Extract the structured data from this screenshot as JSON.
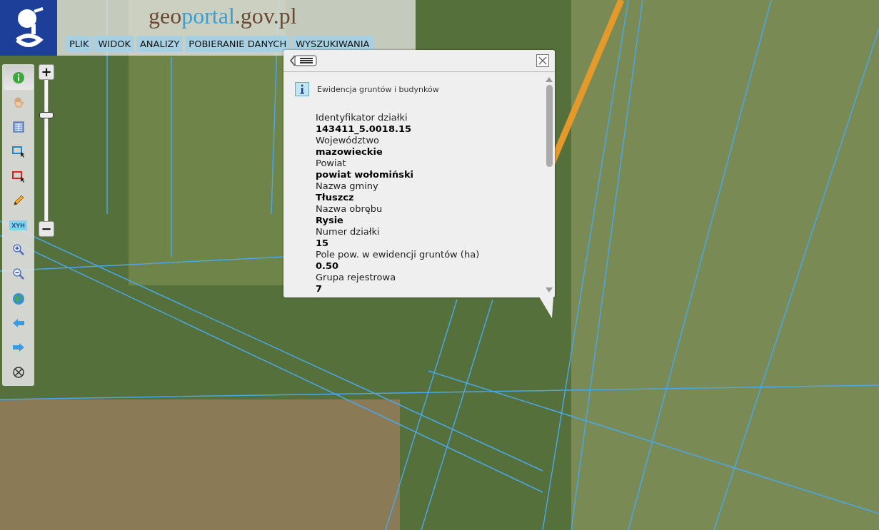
{
  "header": {
    "logo_parts": [
      {
        "text": "geo",
        "color": "#6b4a35"
      },
      {
        "text": "portal",
        "color": "#3a9fd0"
      },
      {
        "text": ".gov.pl",
        "color": "#6b4a35"
      }
    ],
    "menu": [
      {
        "label": "PLIK"
      },
      {
        "label": "WIDOK"
      },
      {
        "label": "ANALIZY"
      },
      {
        "label": "POBIERANIE DANYCH"
      },
      {
        "label": "WYSZUKIWANIA"
      }
    ]
  },
  "toolbar": [
    {
      "kind": "info",
      "selected": true
    },
    {
      "kind": "pan",
      "selected": false
    },
    {
      "kind": "table",
      "selected": false
    },
    {
      "kind": "select-blue",
      "selected": false
    },
    {
      "kind": "select-red",
      "selected": false
    },
    {
      "kind": "pencil",
      "selected": false
    },
    {
      "kind": "xyh",
      "label": "XYH",
      "selected": false
    },
    {
      "kind": "zoom-in",
      "selected": false
    },
    {
      "kind": "zoom-out",
      "selected": false
    },
    {
      "kind": "globe",
      "selected": false
    },
    {
      "kind": "back",
      "selected": false
    },
    {
      "kind": "forward",
      "selected": false
    },
    {
      "kind": "crosshair",
      "selected": false
    }
  ],
  "zoom_slider": {
    "plus": "+",
    "minus": "−",
    "level": 0.76
  },
  "popup": {
    "title": "Ewidencja gruntów i budynków",
    "fields": [
      {
        "label": "Identyfikator działki",
        "value": "143411_5.0018.15"
      },
      {
        "label": "Województwo",
        "value": "mazowieckie"
      },
      {
        "label": "Powiat",
        "value": "powiat wołomiński"
      },
      {
        "label": "Nazwa gminy",
        "value": "Tłuszcz"
      },
      {
        "label": "Nazwa obrębu",
        "value": "Rysie"
      },
      {
        "label": "Numer działki",
        "value": "15"
      },
      {
        "label": "Pole pow. w ewidencji gruntów (ha)",
        "value": "0.50"
      },
      {
        "label": "Grupa rejestrowa",
        "value": "7"
      }
    ]
  }
}
